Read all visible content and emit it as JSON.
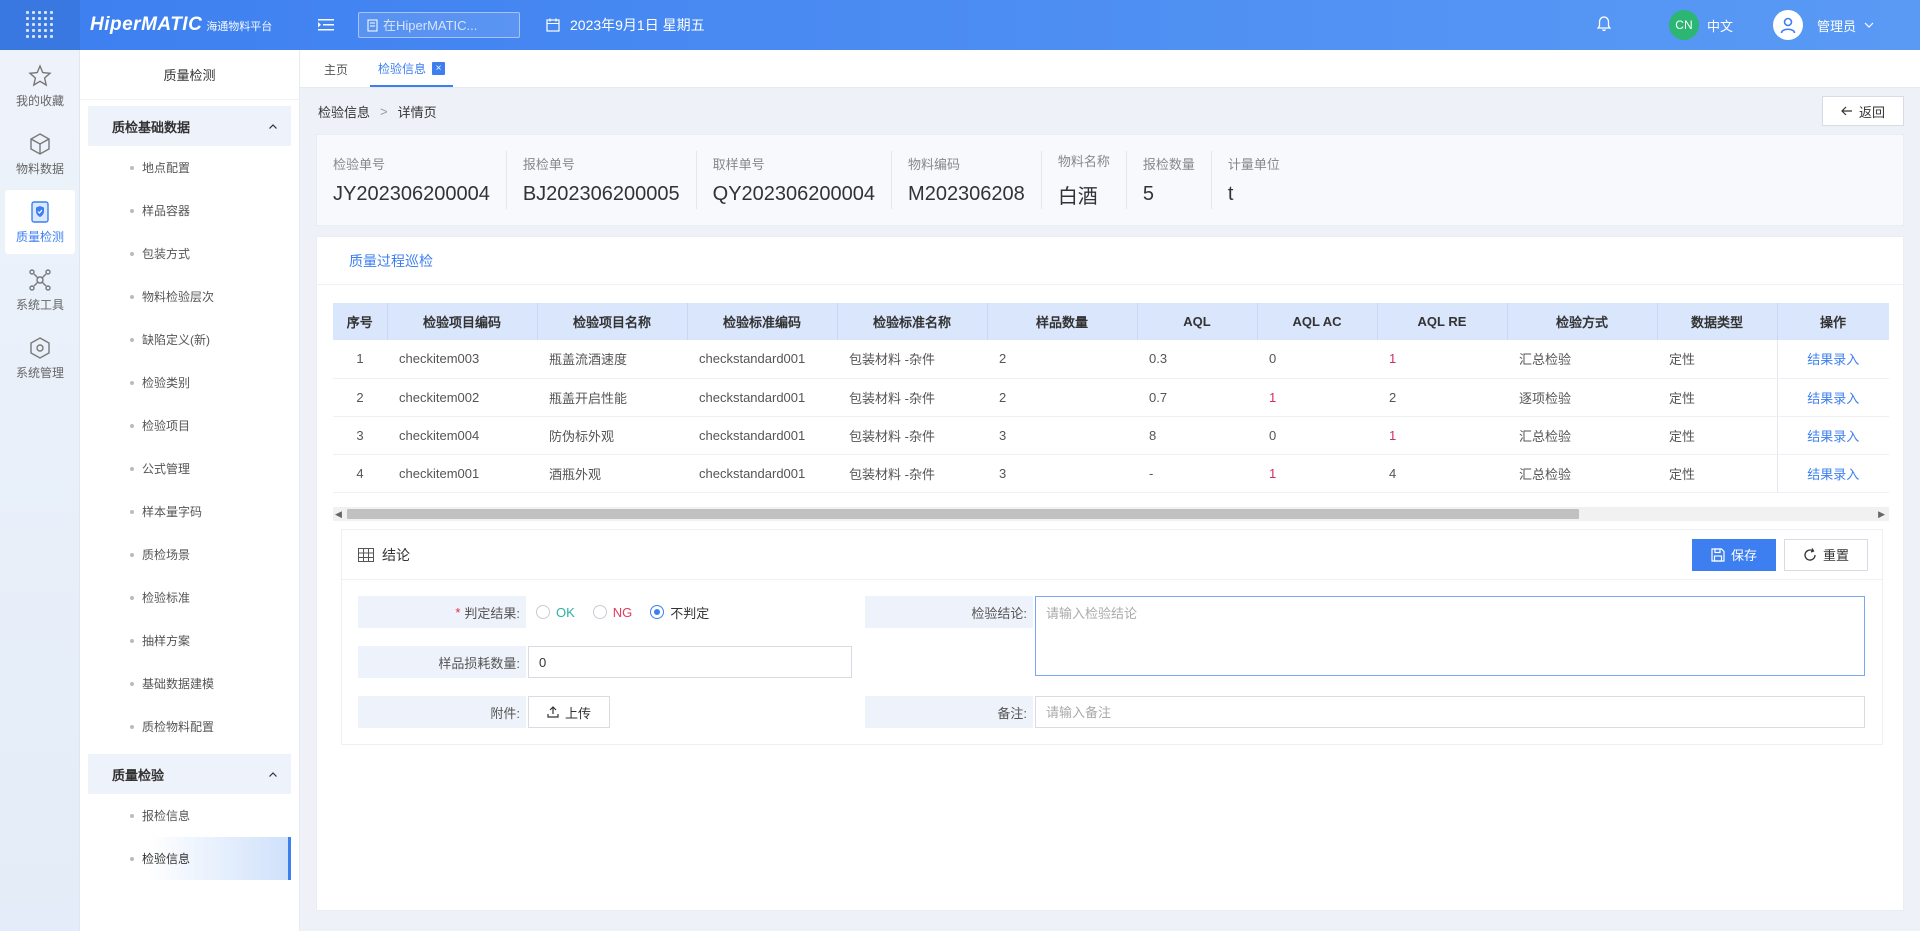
{
  "header": {
    "brand_name": "HiperMATIC",
    "brand_sub": "海通物料平台",
    "search_placeholder": "在HiperMATIC...",
    "date": "2023年9月1日 星期五",
    "lang_badge": "CN",
    "lang_label": "中文",
    "user_name": "管理员"
  },
  "rail": {
    "items": [
      {
        "label": "我的收藏",
        "icon": "star-icon"
      },
      {
        "label": "物料数据",
        "icon": "cube-icon"
      },
      {
        "label": "质量检测",
        "icon": "shield-icon"
      },
      {
        "label": "系统工具",
        "icon": "network-icon"
      },
      {
        "label": "系统管理",
        "icon": "box-icon"
      }
    ]
  },
  "sidemenu": {
    "title": "质量检测",
    "group1": {
      "title": "质检基础数据",
      "items": [
        "地点配置",
        "样品容器",
        "包装方式",
        "物料检验层次",
        "缺陷定义(新)",
        "检验类别",
        "检验项目",
        "公式管理",
        "样本量字码",
        "质检场景",
        "检验标准",
        "抽样方案",
        "基础数据建模",
        "质检物料配置"
      ]
    },
    "group2": {
      "title": "质量检验",
      "items": [
        "报检信息",
        "检验信息"
      ]
    }
  },
  "tabs": {
    "home": "主页",
    "current": "检验信息",
    "close": "×"
  },
  "breadcrumb": {
    "parent": "检验信息",
    "sep": ">",
    "current": "详情页",
    "back": "返回"
  },
  "info": [
    {
      "label": "检验单号",
      "value": "JY202306200004"
    },
    {
      "label": "报检单号",
      "value": "BJ202306200005"
    },
    {
      "label": "取样单号",
      "value": "QY202306200004"
    },
    {
      "label": "物料编码",
      "value": "M202306208"
    },
    {
      "label": "物料名称",
      "value": "白酒"
    },
    {
      "label": "报检数量",
      "value": "5"
    },
    {
      "label": "计量单位",
      "value": "t"
    }
  ],
  "panel_title": "质量过程巡检",
  "table": {
    "headers": [
      "序号",
      "检验项目编码",
      "检验项目名称",
      "检验标准编码",
      "检验标准名称",
      "样品数量",
      "AQL",
      "AQL AC",
      "AQL RE",
      "检验方式",
      "数据类型",
      "操作"
    ],
    "rows": [
      [
        "1",
        "checkitem003",
        "瓶盖流酒速度",
        "checkstandard001",
        "包装材料 -杂件",
        "2",
        "0.3",
        "0",
        "1",
        "汇总检验",
        "定性",
        "结果录入"
      ],
      [
        "2",
        "checkitem002",
        "瓶盖开启性能",
        "checkstandard001",
        "包装材料 -杂件",
        "2",
        "0.7",
        "1",
        "2",
        "逐项检验",
        "定性",
        "结果录入"
      ],
      [
        "3",
        "checkitem004",
        "防伪标外观",
        "checkstandard001",
        "包装材料 -杂件",
        "3",
        "8",
        "0",
        "1",
        "汇总检验",
        "定性",
        "结果录入"
      ],
      [
        "4",
        "checkitem001",
        "酒瓶外观",
        "checkstandard001",
        "包装材料 -杂件",
        "3",
        "-",
        "1",
        "4",
        "汇总检验",
        "定性",
        "结果录入"
      ]
    ]
  },
  "conclusion": {
    "title": "结论",
    "save": "保存",
    "reset": "重置",
    "judge_label": "判定结果:",
    "judge_options": [
      "OK",
      "NG",
      "不判定"
    ],
    "judge_selected": "不判定",
    "loss_label": "样品损耗数量:",
    "loss_value": "0",
    "attach_label": "附件:",
    "upload": "上传",
    "result_label": "检验结论:",
    "result_placeholder": "请输入检验结论",
    "remark_label": "备注:",
    "remark_placeholder": "请输入备注"
  },
  "colors": {
    "primary": "#3d7ff0",
    "ok": "#2bb3a0",
    "ng": "#e03c5c",
    "red_value": "#d32f5d"
  }
}
